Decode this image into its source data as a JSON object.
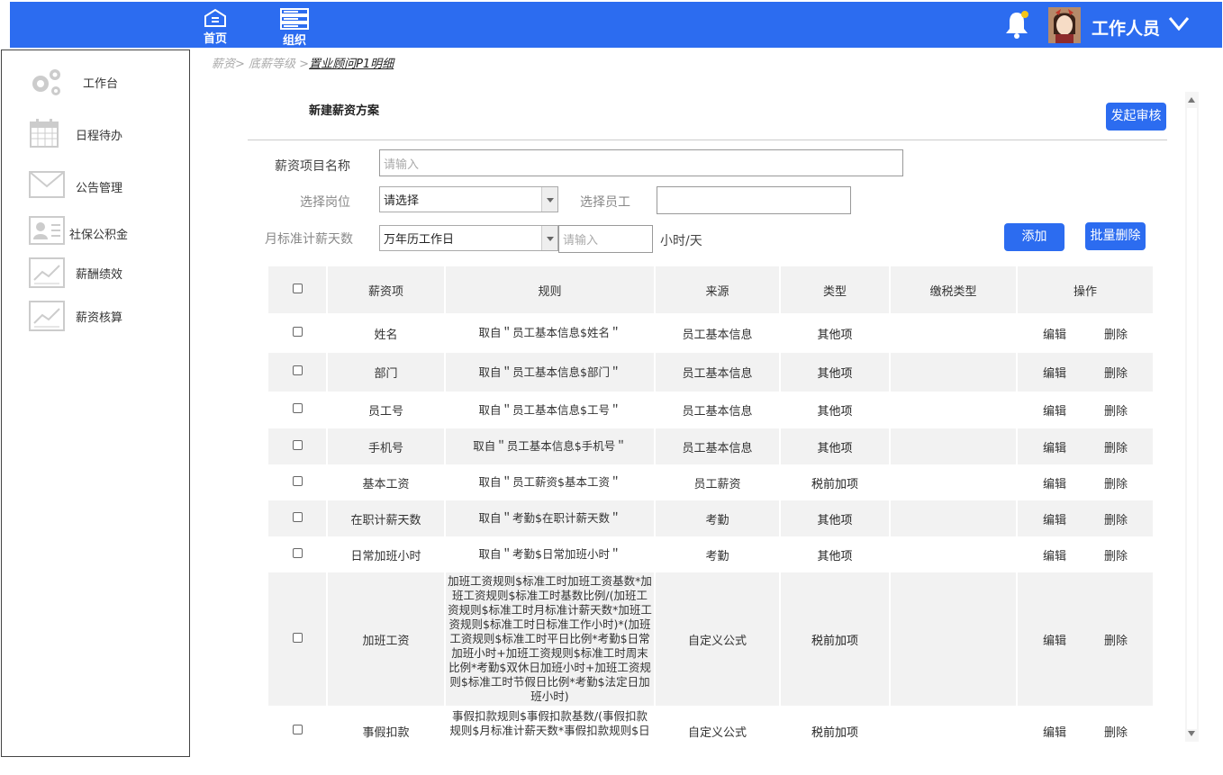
{
  "nav": {
    "home": "首页",
    "org": "组织"
  },
  "user": {
    "name": "工作人员"
  },
  "sidebar": {
    "items": [
      {
        "label": "工作台",
        "icon": "gears-icon"
      },
      {
        "label": "日程待办",
        "icon": "calendar-icon"
      },
      {
        "label": "公告管理",
        "icon": "mail-icon"
      },
      {
        "label": "社保公积金",
        "icon": "id-card-icon"
      },
      {
        "label": "薪酬绩效",
        "icon": "chart-icon"
      },
      {
        "label": "薪资核算",
        "icon": "chart-icon"
      }
    ]
  },
  "breadcrumb": {
    "trail": "薪资> 底薪等级 >",
    "current": "置业顾问P1明细"
  },
  "form": {
    "title": "新建薪资方案",
    "submit_label": "发起审核",
    "name_label": "薪资项目名称",
    "name_placeholder": "请输入",
    "post_label": "选择岗位",
    "post_value": "请选择",
    "employee_label": "选择员工",
    "days_label": "月标准计薪天数",
    "days_value": "万年历工作日",
    "hours_placeholder": "请输入",
    "hours_unit": "小时/天",
    "add_label": "添加",
    "batch_delete_label": "批量删除"
  },
  "table": {
    "headers": [
      "薪资项",
      "规则",
      "来源",
      "类型",
      "缴税类型",
      "操作"
    ],
    "edit": "编辑",
    "delete": "删除",
    "rows": [
      {
        "item": "姓名",
        "rule": "取自＂员工基本信息$姓名＂",
        "source": "员工基本信息",
        "type": "其他项",
        "tax": ""
      },
      {
        "item": "部门",
        "rule": "取自＂员工基本信息$部门＂",
        "source": "员工基本信息",
        "type": "其他项",
        "tax": ""
      },
      {
        "item": "员工号",
        "rule": "取自＂员工基本信息$工号＂",
        "source": "员工基本信息",
        "type": "其他项",
        "tax": ""
      },
      {
        "item": "手机号",
        "rule": "取自＂员工基本信息$手机号＂",
        "source": "员工基本信息",
        "type": "其他项",
        "tax": ""
      },
      {
        "item": "基本工资",
        "rule": "取自＂员工薪资$基本工资＂",
        "source": "员工薪资",
        "type": "税前加项",
        "tax": ""
      },
      {
        "item": "在职计薪天数",
        "rule": "取自＂考勤$在职计薪天数＂",
        "source": "考勤",
        "type": "其他项",
        "tax": ""
      },
      {
        "item": "日常加班小时",
        "rule": "取自＂考勤$日常加班小时＂",
        "source": "考勤",
        "type": "其他项",
        "tax": ""
      },
      {
        "item": "加班工资",
        "rule": "加班工资规则$标准工时加班工资基数*加班工资规则$标准工时基数比例/(加班工资规则$标准工时月标准计薪天数*加班工资规则$标准工时日标准工作小时)*(加班工资规则$标准工时平日比例*考勤$日常加班小时+加班工资规则$标准工时周末比例*考勤$双休日加班小时+加班工资规则$标准工时节假日比例*考勤$法定日加班小时)",
        "source": "自定义公式",
        "type": "税前加项",
        "tax": ""
      },
      {
        "item": "事假扣款",
        "rule": "事假扣款规则$事假扣款基数/(事假扣款规则$月标准计薪天数*事假扣款规则$日",
        "source": "自定义公式",
        "type": "税前加项",
        "tax": ""
      }
    ]
  }
}
